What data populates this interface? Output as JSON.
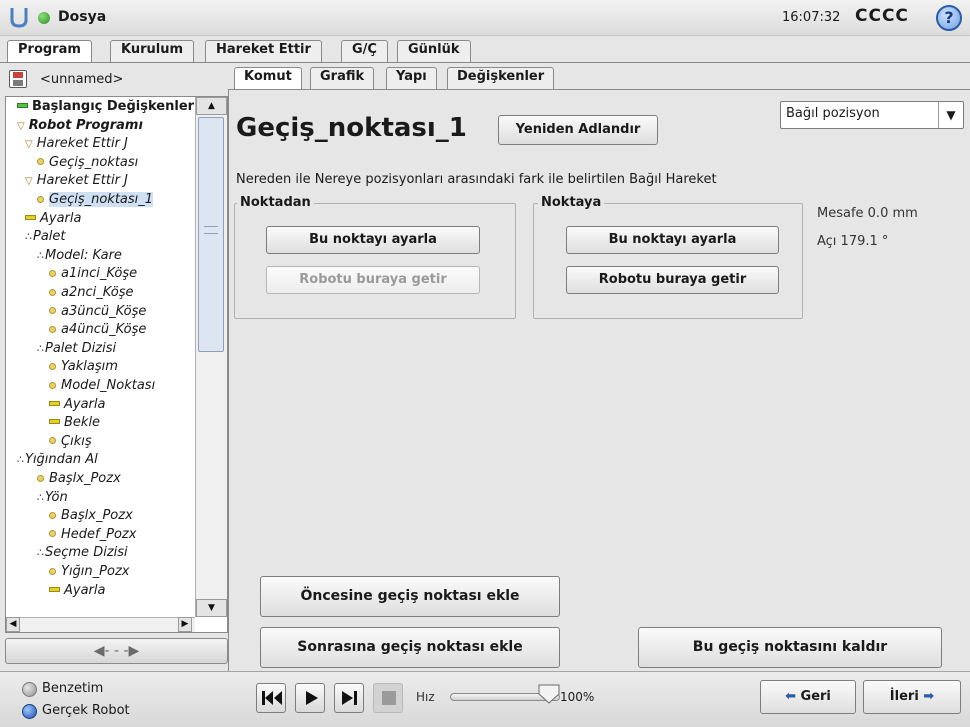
{
  "header": {
    "app_title": "Dosya",
    "clock": "16:07:32",
    "robot_name": "CCCC",
    "help_glyph": "?"
  },
  "top_tabs": [
    "Program",
    "Kurulum",
    "Hareket Ettir",
    "G/Ç",
    "Günlük"
  ],
  "program": {
    "name": "<unnamed>"
  },
  "tree": [
    {
      "label": "Başlangıç Değişkenleri",
      "icon": "dash-green",
      "bold": true,
      "italic": false
    },
    {
      "label": "Robot Programı",
      "icon": "triangle",
      "bold": true
    },
    {
      "label": "Hareket Ettir J",
      "icon": "triangle"
    },
    {
      "label": "Geçiş_noktası",
      "icon": "dot"
    },
    {
      "label": "Hareket Ettir J",
      "icon": "triangle"
    },
    {
      "label": "Geçiş_noktası_1",
      "icon": "dot",
      "selected": true
    },
    {
      "label": "Ayarla",
      "icon": "dash"
    },
    {
      "label": "Palet",
      "icon": "cluster"
    },
    {
      "label": "Model: Kare",
      "icon": "cluster"
    },
    {
      "label": "a1inci_Köşe",
      "icon": "dot"
    },
    {
      "label": "a2nci_Köşe",
      "icon": "dot"
    },
    {
      "label": "a3üncü_Köşe",
      "icon": "dot"
    },
    {
      "label": "a4üncü_Köşe",
      "icon": "dot"
    },
    {
      "label": "Palet Dizisi",
      "icon": "cluster"
    },
    {
      "label": "Yaklaşım",
      "icon": "dot"
    },
    {
      "label": "Model_Noktası",
      "icon": "dot"
    },
    {
      "label": "Ayarla",
      "icon": "dash"
    },
    {
      "label": "Bekle",
      "icon": "dash"
    },
    {
      "label": "Çıkış",
      "icon": "dot"
    },
    {
      "label": "Yığından Al",
      "icon": "cluster"
    },
    {
      "label": "Başlx_Pozx",
      "icon": "dot"
    },
    {
      "label": "Yön",
      "icon": "cluster"
    },
    {
      "label": "Başlx_Pozx",
      "icon": "dot"
    },
    {
      "label": "Hedef_Pozx",
      "icon": "dot"
    },
    {
      "label": "Seçme Dizisi",
      "icon": "cluster"
    },
    {
      "label": "Yığın_Pozx",
      "icon": "dot"
    },
    {
      "label": "Ayarla",
      "icon": "dash"
    }
  ],
  "sub_tabs": [
    "Komut",
    "Grafik",
    "Yapı",
    "Değişkenler"
  ],
  "waypoint": {
    "name": "Geçiş_noktası_1",
    "rename_label": "Yeniden Adlandır",
    "mode_value": "Bağıl pozisyon",
    "description": "Nereden ile Nereye pozisyonları arasındaki fark ile belirtilen Bağıl Hareket",
    "from_group": {
      "title": "Noktadan",
      "set_label": "Bu noktayı ayarla",
      "move_label": "Robotu buraya getir"
    },
    "to_group": {
      "title": "Noktaya",
      "set_label": "Bu noktayı ayarla",
      "move_label": "Robotu buraya getir"
    },
    "distance": "Mesafe 0.0 mm",
    "angle": "Açı 179.1 °",
    "add_before_label": "Öncesine geçiş noktası ekle",
    "add_after_label": "Sonrasına geçiş noktası ekle",
    "remove_label": "Bu geçiş noktasını kaldır"
  },
  "footer": {
    "simulation_label": "Benzetim",
    "real_robot_label": "Gerçek Robot",
    "speed_label": "Hız",
    "speed_value": "100%",
    "speed_fraction": 1.0,
    "back_label": "Geri",
    "next_label": "İleri"
  },
  "colors": {
    "selected_row": "#cfe0f3",
    "status_green": "#2e8b22",
    "accent_blue": "#2a5da8"
  }
}
